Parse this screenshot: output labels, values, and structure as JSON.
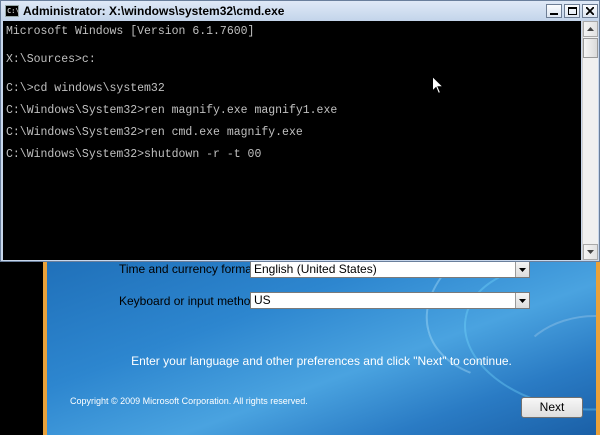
{
  "setup": {
    "time_label": "Time and currency format:",
    "time_value": "English (United States)",
    "keyboard_label": "Keyboard or input method:",
    "keyboard_value": "US",
    "instruction": "Enter your language and other preferences and click \"Next\" to continue.",
    "copyright": "Copyright © 2009 Microsoft Corporation. All rights reserved.",
    "next_label": "Next"
  },
  "cmd": {
    "title": "Administrator: X:\\windows\\system32\\cmd.exe",
    "icon_text": "C:\\",
    "lines": [
      "Microsoft Windows [Version 6.1.7600]",
      "",
      "X:\\Sources>c:",
      "",
      "C:\\>cd windows\\system32",
      "",
      "C:\\Windows\\System32>ren magnify.exe magnify1.exe",
      "",
      "C:\\Windows\\System32>ren cmd.exe magnify.exe",
      "",
      "C:\\Windows\\System32>shutdown -r -t 00"
    ]
  },
  "colors": {
    "console_bg": "#000000",
    "console_text": "#c0c0c0",
    "setup_bg": "#2d86cf",
    "setup_border": "#e9a13a"
  },
  "icons": [
    "cmd-icon",
    "minimize-icon",
    "maximize-icon",
    "close-icon",
    "scroll-up-arrow-icon",
    "scroll-down-arrow-icon",
    "dropdown-arrow-icon",
    "mouse-pointer-icon"
  ]
}
